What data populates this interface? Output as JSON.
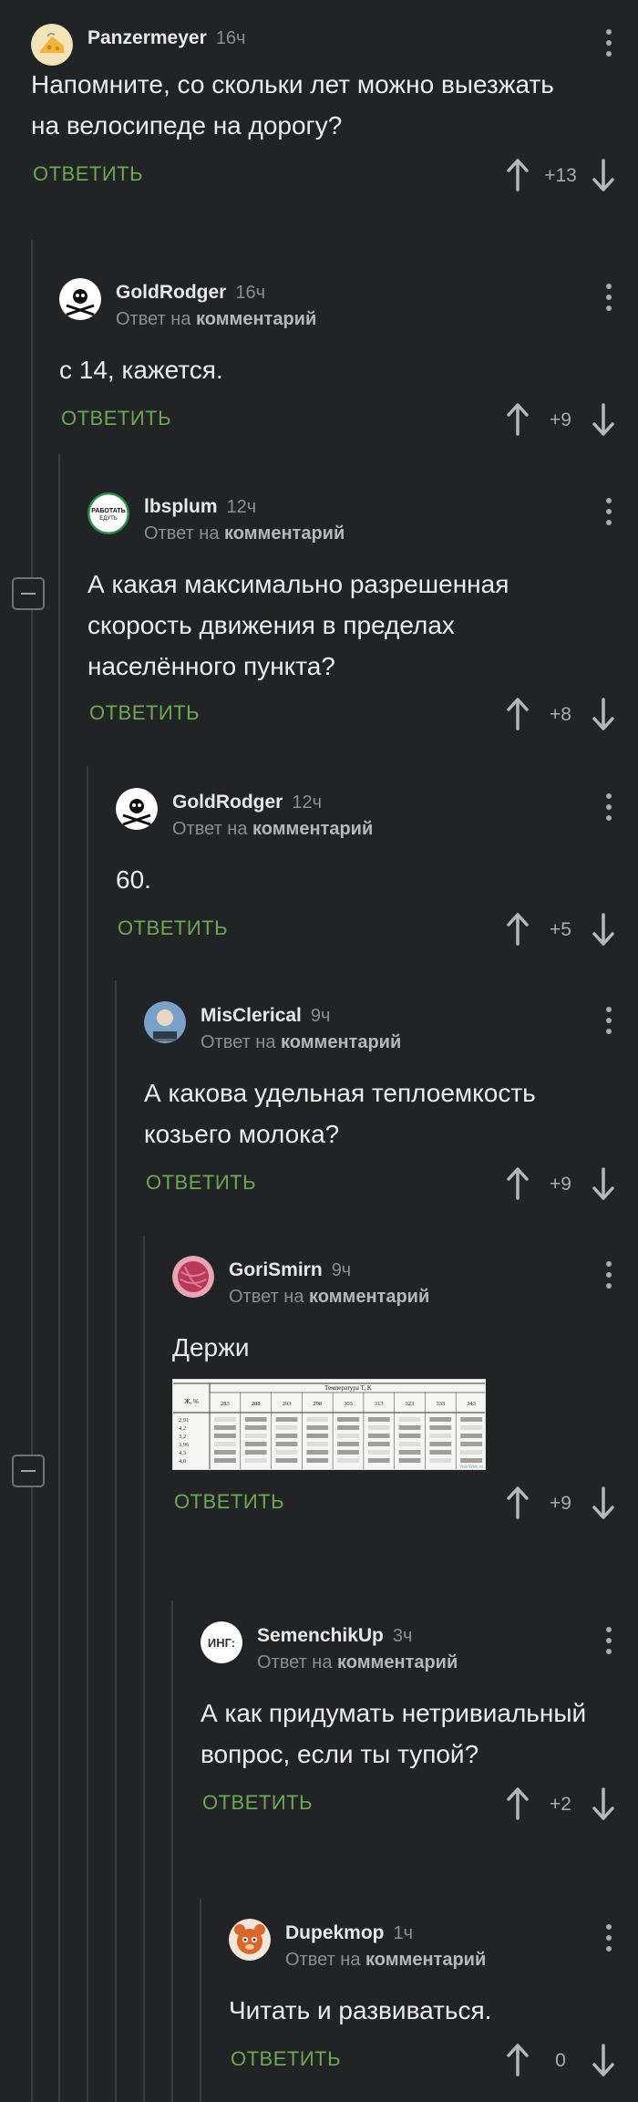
{
  "ui": {
    "reply_label": "ОТВЕТИТЬ",
    "reply_prefix": "Ответ на",
    "reply_target": "комментарий"
  },
  "image_table": {
    "header": "Температура T, K",
    "col0": "Ж, %",
    "temps": [
      "283",
      "288",
      "293",
      "298",
      "303",
      "313",
      "323",
      "333",
      "343"
    ],
    "rows_col0": "2,91\n4,2\n3,2\n3,96\n4,3\n4,0",
    "watermark": "YourWeb.ru"
  },
  "comments": [
    {
      "user": "Panzermeyer",
      "time": "16ч",
      "is_reply": false,
      "text": "Напомните, со скольки лет можно выезжать на велосипеде на дорогу?",
      "score": "+13",
      "avatar": "cheese-avatar"
    },
    {
      "user": "GoldRodger",
      "time": "16ч",
      "is_reply": true,
      "text": "с 14, кажется.",
      "score": "+9",
      "avatar": "jolly-roger-avatar"
    },
    {
      "user": "lbsplum",
      "time": "12ч",
      "is_reply": true,
      "text": "А какая максимально разрешенная скорость движения в пределах населённого пункта?",
      "score": "+8",
      "avatar": "badge-avatar",
      "avatar_text": "РАБОТАТЬ\nЕДУТЬ"
    },
    {
      "user": "GoldRodger",
      "time": "12ч",
      "is_reply": true,
      "text": "60.",
      "score": "+5",
      "avatar": "jolly-roger-avatar"
    },
    {
      "user": "MisClerical",
      "time": "9ч",
      "is_reply": true,
      "text": "А какова удельная теплоемкость козьего молока?",
      "score": "+9",
      "avatar": "photo-avatar"
    },
    {
      "user": "GoriSmirn",
      "time": "9ч",
      "is_reply": true,
      "text": "Держи",
      "score": "+9",
      "avatar": "yarn-avatar"
    },
    {
      "user": "SemenchikUp",
      "time": "3ч",
      "is_reply": true,
      "text": "А как придумать нетривиальный вопрос, если ты тупой?",
      "score": "+2",
      "avatar": "text-logo-avatar",
      "avatar_text": "ИНГ:"
    },
    {
      "user": "Dupekmop",
      "time": "1ч",
      "is_reply": true,
      "text": "Читать и развиваться.",
      "score": "0",
      "avatar": "cartoon-avatar"
    }
  ],
  "colors": {
    "background": "#222325",
    "reply": "#6ca854",
    "meta": "#8a8d92",
    "branch": "#3a3c3f"
  }
}
